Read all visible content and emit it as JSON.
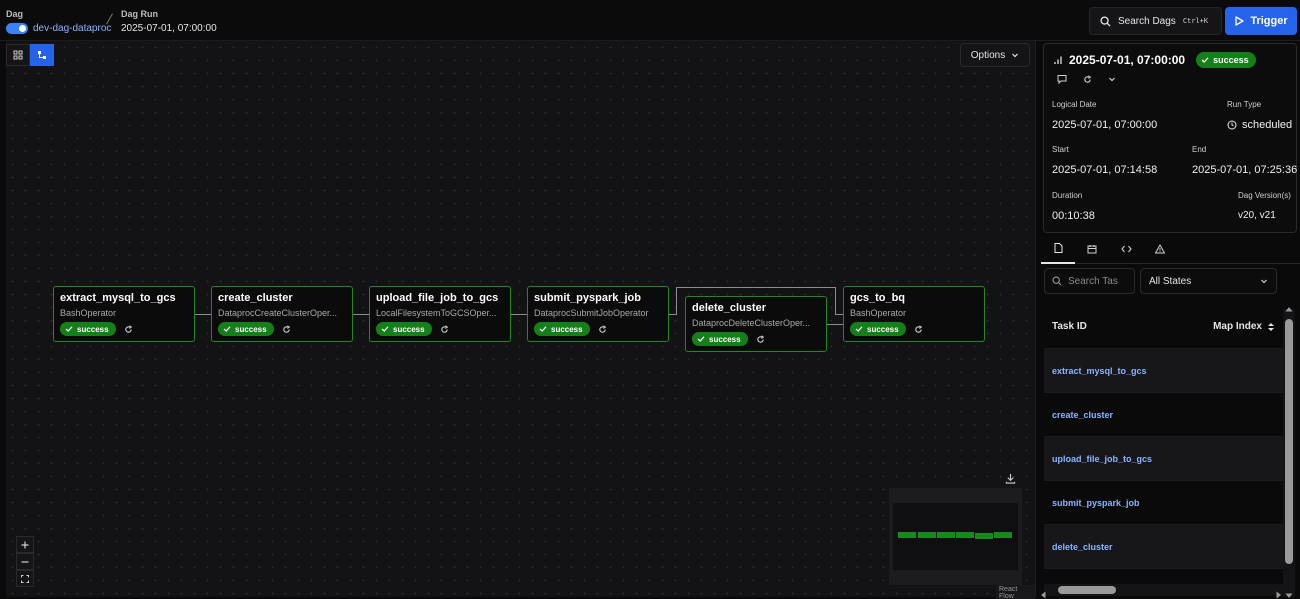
{
  "header": {
    "dag_label": "Dag",
    "dag_id": "dev-dag-dataproc",
    "run_label": "Dag Run",
    "run_value": "2025-07-01, 07:00:00",
    "search_label": "Search Dags",
    "search_shortcut": "Ctrl+K",
    "trigger_label": "Trigger"
  },
  "canvas": {
    "options_label": "Options",
    "react_flow_label": "React Flow",
    "nodes": [
      {
        "name": "extract_mysql_to_gcs",
        "operator": "BashOperator",
        "status": "success"
      },
      {
        "name": "create_cluster",
        "operator": "DataprocCreateClusterOper...",
        "status": "success"
      },
      {
        "name": "upload_file_job_to_gcs",
        "operator": "LocalFilesystemToGCSOper...",
        "status": "success"
      },
      {
        "name": "submit_pyspark_job",
        "operator": "DataprocSubmitJobOperator",
        "status": "success"
      },
      {
        "name": "delete_cluster",
        "operator": "DataprocDeleteClusterOper...",
        "status": "success"
      },
      {
        "name": "gcs_to_bq",
        "operator": "BashOperator",
        "status": "success"
      }
    ]
  },
  "run_summary": {
    "title": "2025-07-01, 07:00:00",
    "status": "success",
    "logical_date_label": "Logical Date",
    "logical_date": "2025-07-01, 07:00:00",
    "run_type_label": "Run Type",
    "run_type": "scheduled",
    "start_label": "Start",
    "start": "2025-07-01, 07:14:58",
    "end_label": "End",
    "end": "2025-07-01, 07:25:36",
    "duration_label": "Duration",
    "duration": "00:10:38",
    "dag_version_label": "Dag Version(s)",
    "dag_version": "v20, v21"
  },
  "task_list": {
    "search_placeholder": "Search Tas",
    "state_filter": "All States",
    "col_task_id": "Task ID",
    "col_map_index": "Map Index",
    "rows": [
      "extract_mysql_to_gcs",
      "create_cluster",
      "upload_file_job_to_gcs",
      "submit_pyspark_job",
      "delete_cluster"
    ]
  },
  "colors": {
    "accent": "#2563eb",
    "success": "#15801a",
    "node_border": "#1f8a1f",
    "link": "#8ab4ff"
  }
}
